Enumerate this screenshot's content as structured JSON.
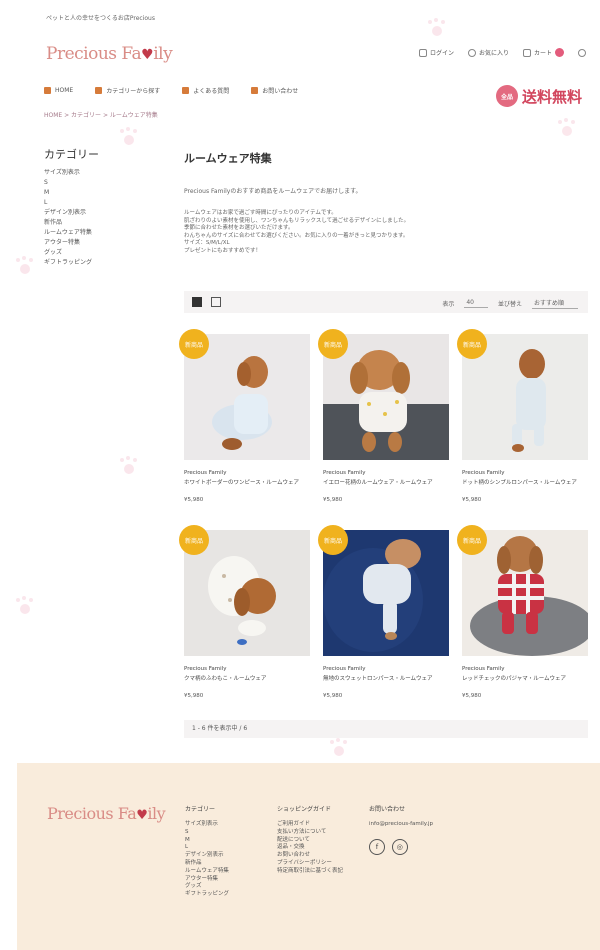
{
  "header": {
    "topline": "ペットと人の幸せをつくるお店Precious",
    "logo_part1": "Precious Fa",
    "logo_heart": "♥",
    "logo_part2": "ily",
    "links": [
      {
        "icon": "user-icon",
        "label": "ログイン"
      },
      {
        "icon": "heart-icon",
        "label": "お気に入り"
      },
      {
        "icon": "cart-icon",
        "label": "カート"
      }
    ],
    "search_icon": "search-icon"
  },
  "nav": {
    "items": [
      "HOME",
      "カテゴリーから探す",
      "よくある質問",
      "お問い合わせ"
    ]
  },
  "freeship": {
    "badge": "全品",
    "text": "送料無料"
  },
  "breadcrumb": "HOME > カテゴリー > ルームウェア特集",
  "sidebar": {
    "title": "カテゴリー",
    "items": [
      "サイズ別表示",
      "S",
      "M",
      "L",
      "デザイン別表示",
      "新作品",
      "ルームウェア特集",
      "アウター特集",
      "グッズ",
      "ギフトラッピング"
    ]
  },
  "main": {
    "title": "ルームウェア特集",
    "intro": "Precious Familyのおすすめ商品をルームウェアでお届けします。",
    "desc": [
      "ルームウェアはお家で過ごす時間にぴったりのアイテムです。",
      "肌ざわりのよい素材を使用し、ワンちゃんもリラックスして過ごせるデザインにしました。",
      "季節に合わせた素材をお選びいただけます。",
      "わんちゃんのサイズに合わせてお選びください。お気に入りの一着がきっと見つかります。",
      "サイズ：S/M/L/XL",
      "プレゼントにもおすすめです！"
    ],
    "toolbar": {
      "view_grid": "grid-view-icon",
      "view_list": "list-view-icon",
      "count_label": "表示",
      "count_value": "40",
      "sort_label": "並び替え",
      "sort_value": "おすすめ順"
    },
    "products": [
      {
        "badge": "新商品",
        "brand": "Precious Family",
        "name": "ホワイトボーダーのワンピース・ルームウェア",
        "price": "¥5,980"
      },
      {
        "badge": "新商品",
        "brand": "Precious Family",
        "name": "イエロー花柄のルームウェア・ルームウェア",
        "price": "¥5,980"
      },
      {
        "badge": "新商品",
        "brand": "Precious Family",
        "name": "ドット柄のシンプルロンパース・ルームウェア",
        "price": "¥5,980"
      },
      {
        "badge": "新商品",
        "brand": "Precious Family",
        "name": "クマ柄のふわもこ・ルームウェア",
        "price": "¥5,980"
      },
      {
        "badge": "新商品",
        "brand": "Precious Family",
        "name": "無地のスウェットロンパース・ルームウェア",
        "price": "¥5,980"
      },
      {
        "badge": "新商品",
        "brand": "Precious Family",
        "name": "レッドチェックのパジャマ・ルームウェア",
        "price": "¥5,980"
      }
    ],
    "pager": "1 - 6 件を表示中 / 6"
  },
  "footer": {
    "logo_part1": "Precious Fa",
    "logo_heart": "♥",
    "logo_part2": "ily",
    "col1": {
      "title": "カテゴリー",
      "items": [
        "サイズ別表示",
        "S",
        "M",
        "L",
        "デザイン別表示",
        "新作品",
        "ルームウェア特集",
        "アウター特集",
        "グッズ",
        "ギフトラッピング"
      ]
    },
    "col2": {
      "title": "ショッピングガイド",
      "items": [
        "ご利用ガイド",
        "支払い方法について",
        "配送について",
        "返品・交換",
        "お問い合わせ",
        "プライバシーポリシー",
        "特定商取引法に基づく表記"
      ]
    },
    "col3": {
      "title": "お問い合わせ",
      "email": "info@precious-family.jp",
      "social": [
        "f",
        "◎"
      ]
    }
  },
  "colors": {
    "accent": "#d2465e",
    "badge": "#f0b21e",
    "footer_bg": "#f9ecdc"
  }
}
